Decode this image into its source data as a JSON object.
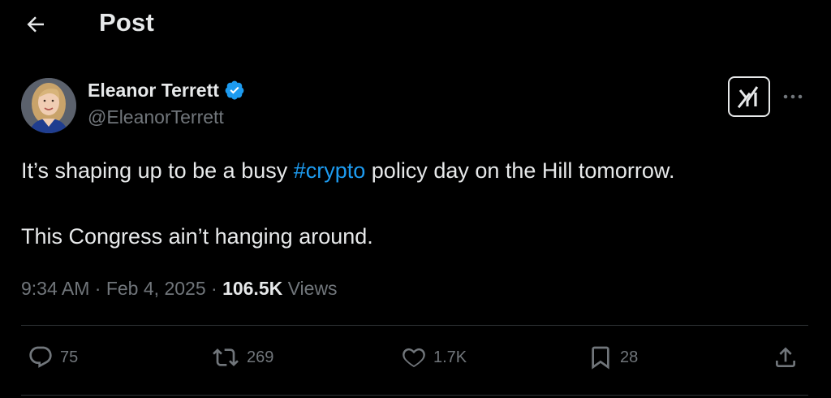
{
  "header": {
    "back_icon": "arrow-left-icon",
    "title": "Post"
  },
  "author": {
    "name": "Eleanor Terrett",
    "handle": "@EleanorTerrett",
    "verified": true,
    "verified_color": "#1d9bf0"
  },
  "tweet": {
    "line1_before": "It’s shaping up to be a busy ",
    "hashtag": "#crypto",
    "line1_after": " policy day on the Hill tomorrow.",
    "line2": "This Congress ain’t hanging around."
  },
  "meta": {
    "time": "9:34 AM",
    "separator": " · ",
    "date": "Feb 4, 2025",
    "views_count": "106.5K",
    "views_label": " Views"
  },
  "actions": {
    "replies": "75",
    "reposts": "269",
    "likes": "1.7K",
    "bookmarks": "28"
  },
  "colors": {
    "background": "#000000",
    "text": "#e7e9ea",
    "muted": "#71767b",
    "accent": "#1d9bf0",
    "divider": "#2f3336"
  }
}
